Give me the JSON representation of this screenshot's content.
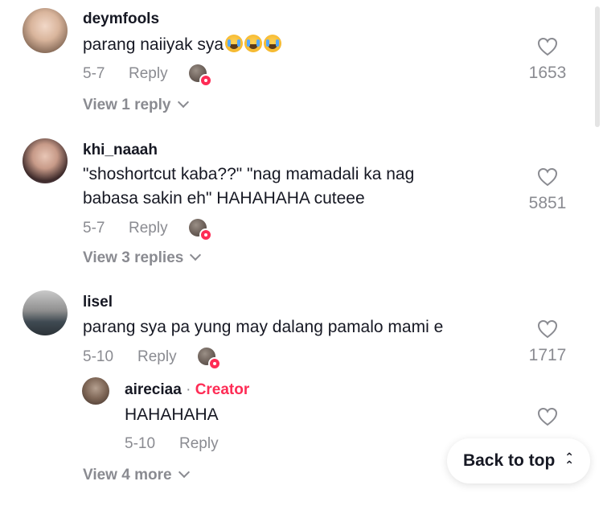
{
  "comments": [
    {
      "username": "deymfools",
      "text": "parang naiiyak sya",
      "emoji": [
        "crying-face",
        "crying-face",
        "crying-face"
      ],
      "date": "5-7",
      "reply_label": "Reply",
      "likes": "1653",
      "view_replies": "View 1 reply"
    },
    {
      "username": "khi_naaah",
      "text_line1": "\"shoshortcut kaba??\" \"nag mamadali ka nag",
      "text_line2": "babasa sakin eh\" HAHAHAHA cuteee",
      "date": "5-7",
      "reply_label": "Reply",
      "likes": "5851",
      "view_replies": "View 3 replies"
    },
    {
      "username": "lisel",
      "text": "parang sya pa yung may dalang pamalo mami e",
      "date": "5-10",
      "reply_label": "Reply",
      "likes": "1717",
      "reply": {
        "username": "aireciaa",
        "separator": "·",
        "badge": "Creator",
        "text": "HAHAHAHA",
        "date": "5-10",
        "reply_label": "Reply"
      },
      "view_more": "View 4 more"
    }
  ],
  "back_to_top": "Back to top",
  "colors": {
    "accent": "#fe2c55",
    "muted": "#8a8b91",
    "text": "#161823"
  }
}
